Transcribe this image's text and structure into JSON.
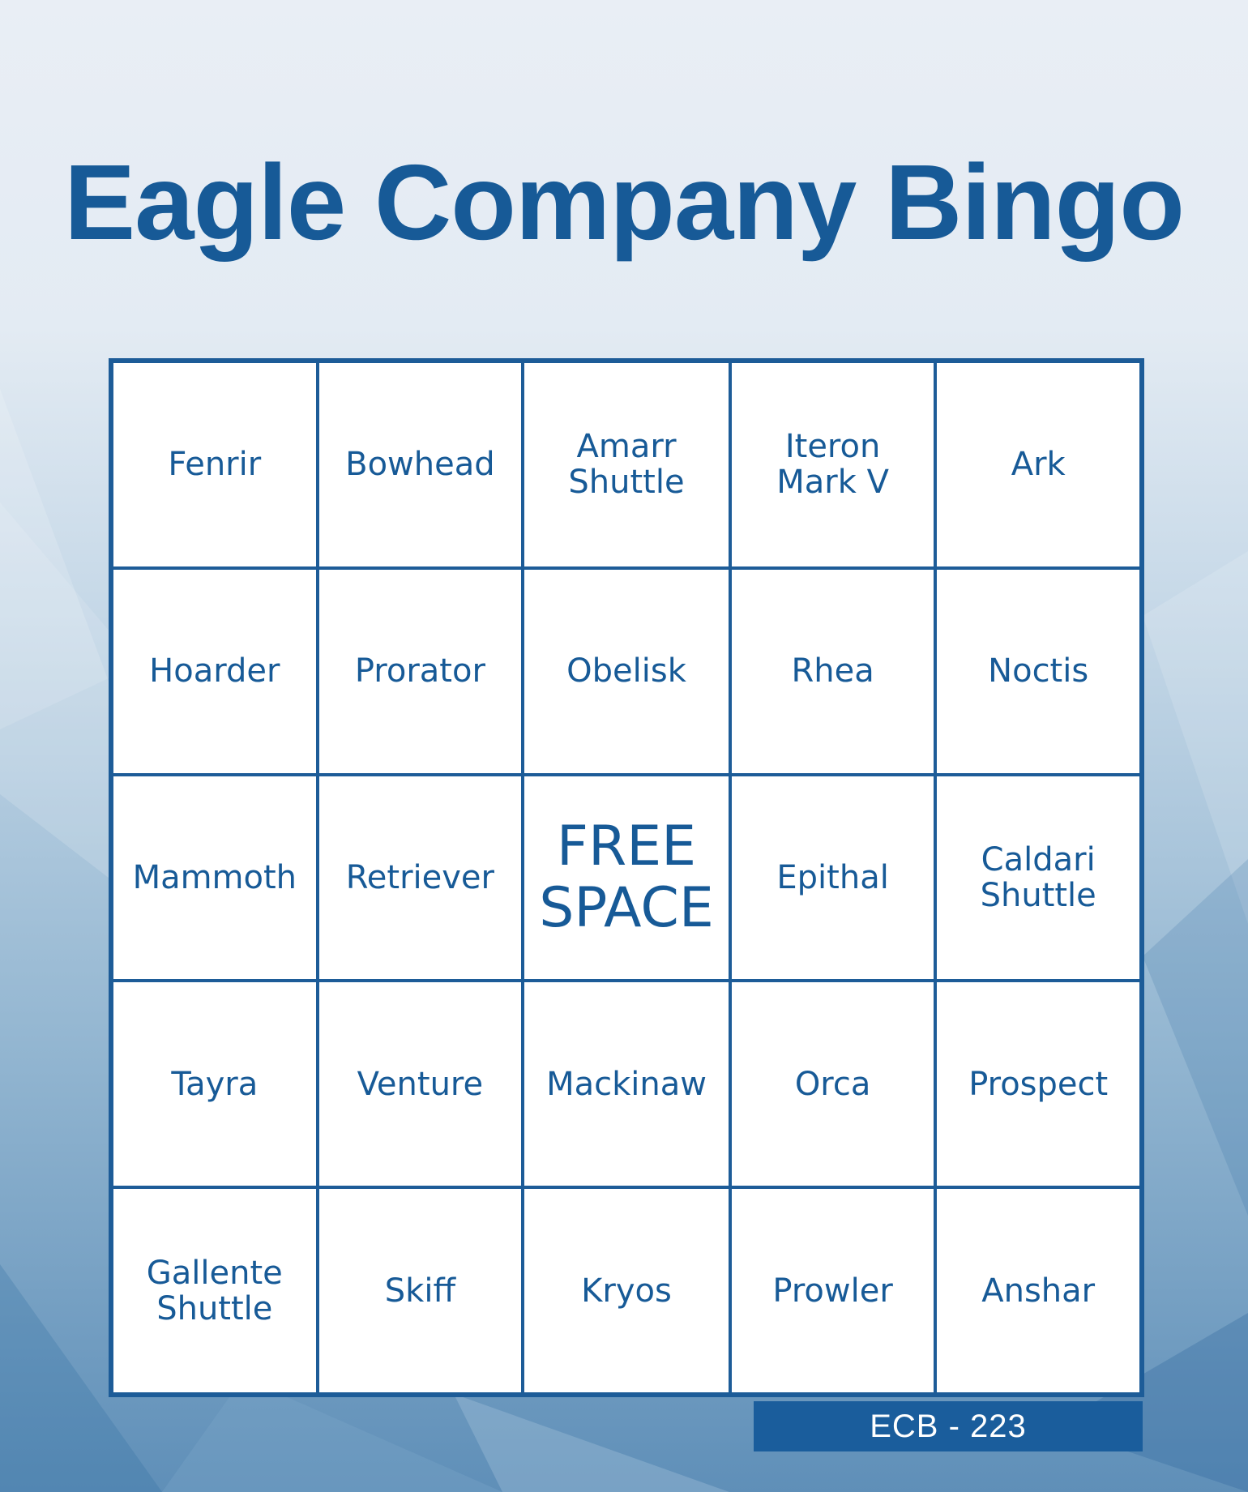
{
  "title": "Eagle Company Bingo",
  "colors": {
    "primary": "#175a97",
    "cell_background": "#ffffff",
    "background_top": "#e9eef5",
    "background_bottom": "#5f8fb8"
  },
  "card": {
    "cells": [
      {
        "label": "Fenrir"
      },
      {
        "label": "Bowhead"
      },
      {
        "label": "Amarr\nShuttle"
      },
      {
        "label": "Iteron\nMark V"
      },
      {
        "label": "Ark"
      },
      {
        "label": "Hoarder"
      },
      {
        "label": "Prorator"
      },
      {
        "label": "Obelisk"
      },
      {
        "label": "Rhea"
      },
      {
        "label": "Noctis"
      },
      {
        "label": "Mammoth"
      },
      {
        "label": "Retriever"
      },
      {
        "label": "FREE\nSPACE"
      },
      {
        "label": "Epithal"
      },
      {
        "label": "Caldari\nShuttle"
      },
      {
        "label": "Tayra"
      },
      {
        "label": "Venture"
      },
      {
        "label": "Mackinaw"
      },
      {
        "label": "Orca"
      },
      {
        "label": "Prospect"
      },
      {
        "label": "Gallente\nShuttle"
      },
      {
        "label": "Skiff"
      },
      {
        "label": "Kryos"
      },
      {
        "label": "Prowler"
      },
      {
        "label": "Anshar"
      }
    ],
    "id_label": "ECB - 223"
  }
}
